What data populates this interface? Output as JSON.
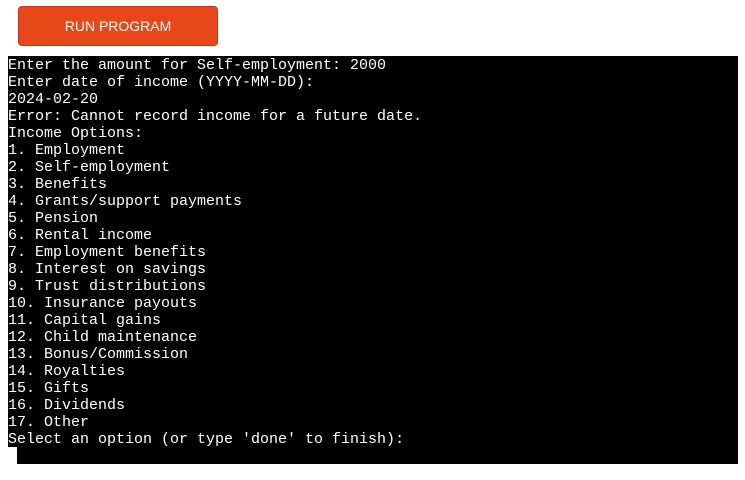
{
  "toolbar": {
    "run_label": "RUN PROGRAM"
  },
  "terminal": {
    "lines": [
      "Enter the amount for Self-employment: 2000",
      "Enter date of income (YYYY-MM-DD):",
      "2024-02-20",
      "Error: Cannot record income for a future date.",
      "Income Options:",
      "1. Employment",
      "2. Self-employment",
      "3. Benefits",
      "4. Grants/support payments",
      "5. Pension",
      "6. Rental income",
      "7. Employment benefits",
      "8. Interest on savings",
      "9. Trust distributions",
      "10. Insurance payouts",
      "11. Capital gains",
      "12. Child maintenance",
      "13. Bonus/Commission",
      "14. Royalties",
      "15. Gifts",
      "16. Dividends",
      "17. Other",
      "Select an option (or type 'done' to finish):"
    ]
  },
  "colors": {
    "button_bg": "#e8471a",
    "terminal_bg": "#000000",
    "terminal_text": "#ffffff"
  }
}
